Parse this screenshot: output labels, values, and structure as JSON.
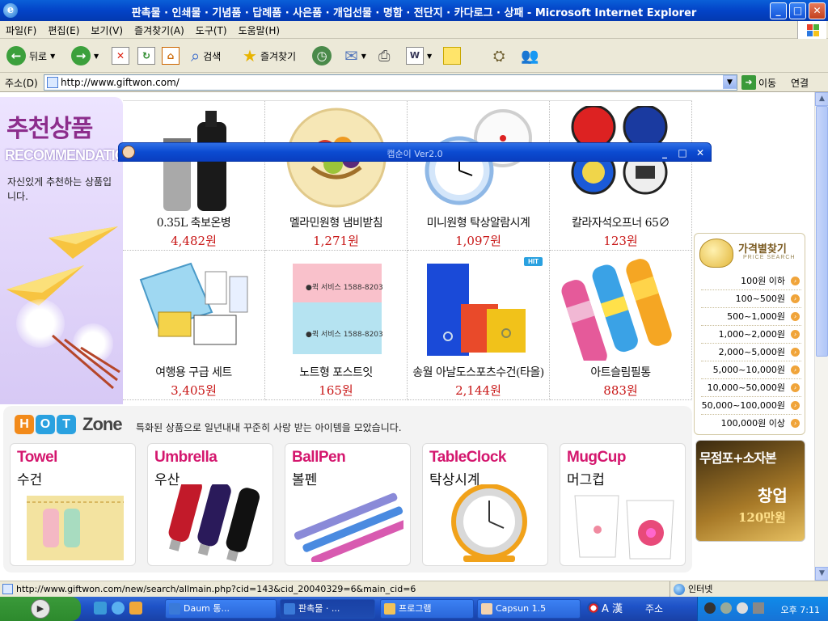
{
  "window": {
    "title": "판촉물 · 인쇄물 · 기념품 · 답례품 · 사은품 · 개업선물 · 명함 · 전단지 · 카다로그 · 상패 - Microsoft Internet Explorer",
    "min": "_",
    "max": "□",
    "close": "✕"
  },
  "menu": [
    "파일(F)",
    "편집(E)",
    "보기(V)",
    "즐겨찾기(A)",
    "도구(T)",
    "도움말(H)"
  ],
  "toolbar": {
    "back": "뒤로",
    "search": "검색",
    "favorites": "즐겨찾기"
  },
  "address": {
    "label": "주소(D)",
    "url": "http://www.giftwon.com/",
    "go": "이동",
    "links": "연결"
  },
  "rec": {
    "title": "추천상품",
    "title_en": "RECOMMENDATION",
    "desc": "자신있게 추천하는 상품입니다."
  },
  "products": [
    {
      "name": "0.35L 축보온병",
      "price": "4,482원"
    },
    {
      "name": "멜라민원형 냄비받침",
      "price": "1,271원"
    },
    {
      "name": "미니원형 탁상알람시계",
      "price": "1,097원"
    },
    {
      "name": "칼라자석오프너 65∅",
      "price": "123원"
    },
    {
      "name": "여행용 구급 세트",
      "price": "3,405원"
    },
    {
      "name": "노트형 포스트잇",
      "price": "165원"
    },
    {
      "name": "송월 아날도스포츠수건(타올)",
      "price": "2,144원"
    },
    {
      "name": "아트슬림필통",
      "price": "883원"
    }
  ],
  "hit_badge": "HIT",
  "price_search": {
    "title": "가격별찾기",
    "subtitle": "PRICE SEARCH",
    "ranges": [
      "100원 이하",
      "100~500원",
      "500~1,000원",
      "1,000~2,000원",
      "2,000~5,000원",
      "5,000~10,000원",
      "10,000~50,000원",
      "50,000~100,000원",
      "100,000원 이상"
    ]
  },
  "ad": {
    "line1": "무점포+소자본",
    "line2": "창업",
    "line3": "120만원"
  },
  "hot_zone": {
    "letters": [
      "H",
      "O",
      "T"
    ],
    "zone": "Zone",
    "desc": "특화된 상품으로 일년내내 꾸준히 사랑 받는 아이템을 모았습니다.",
    "cards": [
      {
        "en": "Towel",
        "ko": "수건"
      },
      {
        "en": "Umbrella",
        "ko": "우산"
      },
      {
        "en": "BallPen",
        "ko": "볼펜"
      },
      {
        "en": "TableClock",
        "ko": "탁상시계"
      },
      {
        "en": "MugCup",
        "ko": "머그컵"
      }
    ]
  },
  "capsun": {
    "title": "캡순이 Ver2.0"
  },
  "status": {
    "url": "http://www.giftwon.com/new/search/allmain.php?cid=143&cid_20040329=6&main_cid=6",
    "zone": "인터넷"
  },
  "taskbar": {
    "tasks": [
      "Daum 통...",
      "판촉물 · ...",
      "프로그램",
      "Capsun 1.5"
    ],
    "lang": "A 漢",
    "juso": "주소",
    "clock": "오후 7:11"
  },
  "colors": {
    "accent": "#0a5fd8",
    "price": "#c81616",
    "hot_pink": "#d4176e"
  }
}
